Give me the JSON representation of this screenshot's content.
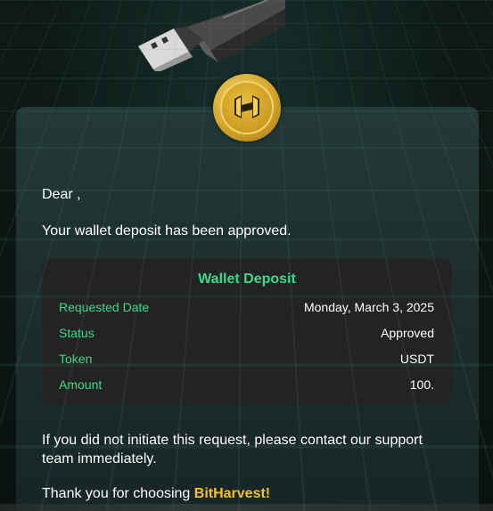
{
  "email": {
    "greeting": "Dear ,",
    "message": "Your wallet deposit has been approved.",
    "deposit": {
      "title": "Wallet Deposit",
      "rows": [
        {
          "label": "Requested Date",
          "value": "Monday, March 3, 2025"
        },
        {
          "label": "Status",
          "value": "Approved"
        },
        {
          "label": "Token",
          "value": "USDT"
        },
        {
          "label": "Amount",
          "value": "100."
        }
      ]
    },
    "closing": "If you did not initiate this request, please contact our support team immediately.",
    "thanks_prefix": "Thank you for choosing ",
    "brand_name": "BitHarvest!"
  },
  "icons": {
    "hero": "usb-drive-icon",
    "logo": "bitharvest-coin-logo"
  },
  "colors": {
    "accent_green": "#3bd98a",
    "brand_gold": "#f5c02e",
    "card_bg": "#1f3332",
    "box_bg": "#232323"
  }
}
